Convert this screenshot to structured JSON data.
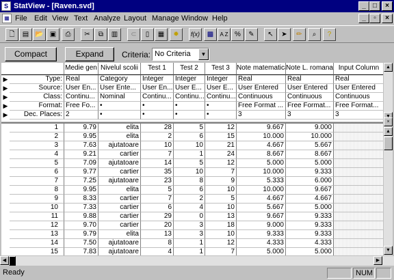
{
  "window": {
    "title": "StatView - [Raven.svd]"
  },
  "menu": [
    "File",
    "Edit",
    "View",
    "Text",
    "Analyze",
    "Layout",
    "Manage",
    "Window",
    "Help"
  ],
  "toolbar": {
    "icons": [
      "new-doc-icon",
      "new-view-icon",
      "open-folder-icon",
      "save-icon",
      "print-icon",
      "cut-icon",
      "copy-icon",
      "paste-icon",
      "link-icon",
      "clipboard-icon",
      "table-icon",
      "sun-icon",
      "formula-icon",
      "grid-icon",
      "sort-az-icon",
      "symbols-icon",
      "brush-icon",
      "pointer-tool-icon",
      "arrow-tool-icon",
      "pencil-icon",
      "zoom-icon",
      "help-icon"
    ],
    "formula_label": "f(x)",
    "sort_label": "A Z"
  },
  "controls": {
    "compact_label": "Compact",
    "expand_label": "Expand",
    "criteria_label": "Criteria:",
    "criteria_value": "No Criteria"
  },
  "columns": [
    "Medie gen",
    "Nivelul scolii",
    "Test 1",
    "Test 2",
    "Test 3",
    "Note matematica",
    "Note L. romana",
    "Input Column"
  ],
  "attr_rows": [
    {
      "label": "Type:",
      "values": [
        "Real",
        "Category",
        "Integer",
        "Integer",
        "Integer",
        "Real",
        "Real",
        "Real"
      ]
    },
    {
      "label": "Source:",
      "values": [
        "User En...",
        "User Ente...",
        "User En...",
        "User E...",
        "User E...",
        "User Entered",
        "User Entered",
        "User Entered"
      ]
    },
    {
      "label": "Class:",
      "values": [
        "Continu...",
        "Nominal",
        "Continu...",
        "Continu...",
        "Continu...",
        "Continuous",
        "Continuous",
        "Continuous"
      ]
    },
    {
      "label": "Format:",
      "values": [
        "Free Fo...",
        "•",
        "•",
        "•",
        "•",
        "Free Format ...",
        "Free Format...",
        "Free Format..."
      ]
    },
    {
      "label": "Dec. Places:",
      "values": [
        "2",
        "•",
        "•",
        "•",
        "•",
        "3",
        "3",
        "3"
      ]
    }
  ],
  "data_rows": [
    [
      "1",
      "9.79",
      "elita",
      "28",
      "5",
      "12",
      "9.667",
      "9.000"
    ],
    [
      "2",
      "9.95",
      "elita",
      "2",
      "6",
      "15",
      "10.000",
      "10.000"
    ],
    [
      "3",
      "7.63",
      "ajutatoare",
      "10",
      "10",
      "21",
      "4.667",
      "5.667"
    ],
    [
      "4",
      "9.21",
      "cartier",
      "7",
      "1",
      "24",
      "8.667",
      "8.667"
    ],
    [
      "5",
      "7.09",
      "ajutatoare",
      "14",
      "5",
      "12",
      "5.000",
      "5.000"
    ],
    [
      "6",
      "9.77",
      "cartier",
      "35",
      "10",
      "7",
      "10.000",
      "9.333"
    ],
    [
      "7",
      "7.25",
      "ajutatoare",
      "23",
      "8",
      "9",
      "5.333",
      "6.000"
    ],
    [
      "8",
      "9.95",
      "elita",
      "5",
      "6",
      "10",
      "10.000",
      "9.667"
    ],
    [
      "9",
      "8.33",
      "cartier",
      "7",
      "2",
      "5",
      "4.667",
      "4.667"
    ],
    [
      "10",
      "7.33",
      "cartier",
      "6",
      "4",
      "10",
      "5.667",
      "5.000"
    ],
    [
      "11",
      "9.88",
      "cartier",
      "29",
      "0",
      "13",
      "9.667",
      "9.333"
    ],
    [
      "12",
      "9.70",
      "cartier",
      "20",
      "3",
      "18",
      "9.000",
      "9.333"
    ],
    [
      "13",
      "9.79",
      "elita",
      "13",
      "3",
      "10",
      "9.333",
      "9.333"
    ],
    [
      "14",
      "7.50",
      "ajutatoare",
      "8",
      "1",
      "12",
      "4.333",
      "4.333"
    ],
    [
      "15",
      "7.83",
      "ajutatoare",
      "4",
      "1",
      "7",
      "5.000",
      "5.000"
    ]
  ],
  "status": {
    "text": "Ready",
    "num": "NUM"
  }
}
